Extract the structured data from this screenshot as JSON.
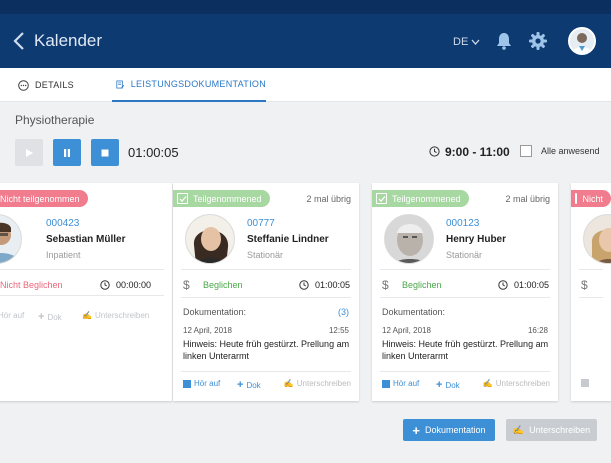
{
  "header": {
    "title": "Kalender",
    "language": "DE"
  },
  "tabs": [
    {
      "label": "DETAILS"
    },
    {
      "label": "LEISTUNGSDOKUMENTATION"
    }
  ],
  "section_title": "Physiotherapie",
  "session": {
    "elapsed": "01:00:05",
    "time_range": "9:00 - 11:00",
    "all_present_label": "Alle anwesend"
  },
  "cards": [
    {
      "badge": "Nicht teilgenommen",
      "id": "000423",
      "name": "Sebastian Müller",
      "type": "Inpatient",
      "payment": "Nicht Beglichen",
      "duration": "00:00:00",
      "actions": {
        "hoer": "Hör auf",
        "dok": "Dok",
        "sign": "Unterschreiben"
      }
    },
    {
      "badge": "Teilgenommened",
      "remaining": "2 mal übrig",
      "id": "00777",
      "name": "Steffanie Lindner",
      "type": "Stationär",
      "payment": "Beglichen",
      "duration": "01:00:05",
      "dok_label": "Dokumentation:",
      "dok_count": "(3)",
      "date": "12  April, 2018",
      "time": "12:55",
      "note": "Hinweis: Heute früh gestürzt. Prellung am linken Unterarmt",
      "actions": {
        "hoer": "Hör auf",
        "dok": "Dok",
        "sign": "Unterschreiben"
      }
    },
    {
      "badge": "Teilgenommened",
      "remaining": "2 mal übrig",
      "id": "000123",
      "name": "Henry Huber",
      "type": "Stationär",
      "payment": "Beglichen",
      "duration": "01:00:05",
      "dok_label": "Dokumentation:",
      "date": "12  April, 2018",
      "time": "16:28",
      "note": "Hinweis: Heute früh gestürzt. Prellung am linken Unterarmt",
      "actions": {
        "hoer": "Hör auf",
        "dok": "Dok",
        "sign": "Unterschreiben"
      }
    },
    {
      "badge": "Nicht"
    }
  ],
  "footer": {
    "add_doc": "Dokumentation",
    "sign": "Unterschreiben"
  },
  "colors": {
    "header_bg": "#0e3a72",
    "accent": "#3d8fd6",
    "success_badge": "#a7d8a1",
    "error_badge": "#f07c8e"
  }
}
